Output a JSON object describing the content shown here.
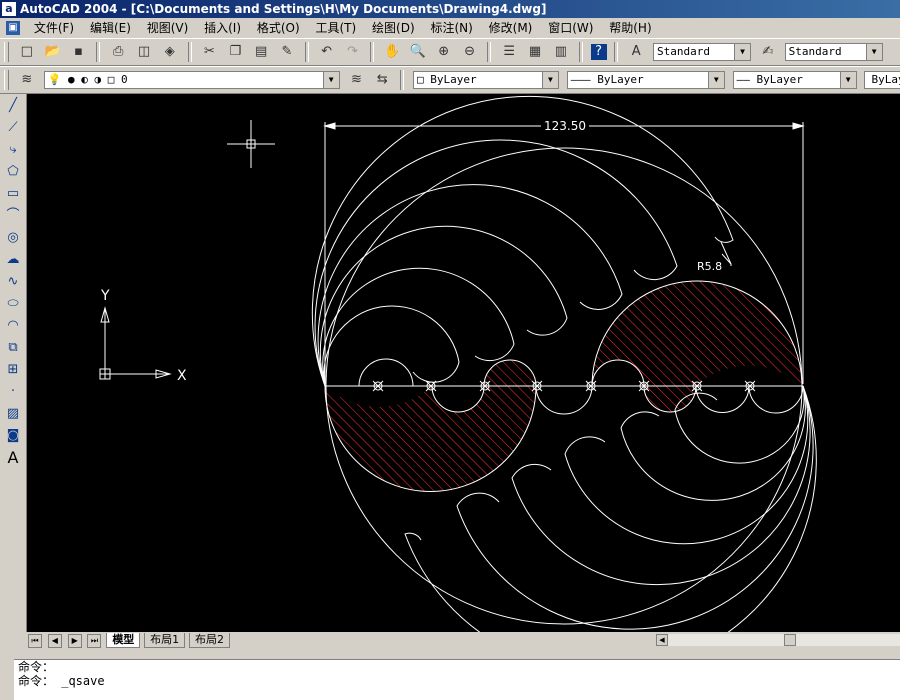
{
  "window": {
    "title": "AutoCAD 2004 - [C:\\Documents and Settings\\H\\My Documents\\Drawing4.dwg]"
  },
  "menu": [
    "文件(F)",
    "编辑(E)",
    "视图(V)",
    "插入(I)",
    "格式(O)",
    "工具(T)",
    "绘图(D)",
    "标注(N)",
    "修改(M)",
    "窗口(W)",
    "帮助(H)"
  ],
  "toolbar": {
    "text_style": "Standard",
    "dim_style": "Standard"
  },
  "properties": {
    "layer": "0",
    "color": "ByLayer",
    "linetype": "ByLayer",
    "lineweight": "ByLayer",
    "plotstyle": "ByLayer"
  },
  "drawing": {
    "dimension_text": "123.50",
    "radius_label": "R5.8",
    "ucs_x": "X",
    "ucs_y": "Y"
  },
  "tabs": [
    "模型",
    "布局1",
    "布局2"
  ],
  "command": {
    "line1": "命令：",
    "line2": "命令： _qsave"
  },
  "colors": {
    "canvas": "#000000",
    "geometry": "#ffffff",
    "hatch": "#ff3030",
    "titlebar": "#0a246a"
  }
}
